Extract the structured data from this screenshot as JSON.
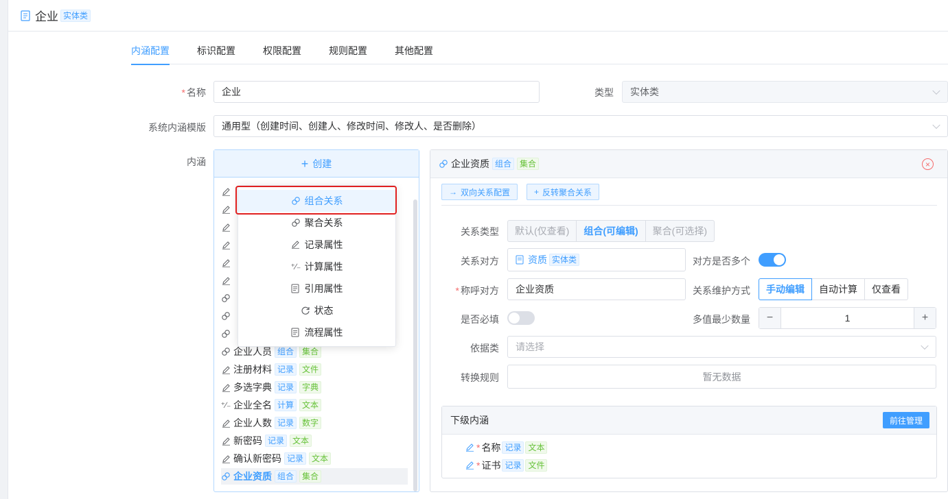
{
  "header": {
    "title": "企业",
    "tag": "实体类"
  },
  "tabs": [
    "内涵配置",
    "标识配置",
    "权限配置",
    "规则配置",
    "其他配置"
  ],
  "form": {
    "name_label": "名称",
    "name_value": "企业",
    "type_label": "类型",
    "type_value": "实体类",
    "template_label": "系统内涵模版",
    "template_value": "通用型（创建时间、创建人、修改时间、修改人、是否删除）",
    "connotation_label": "内涵"
  },
  "list_panel": {
    "create_label": "创建",
    "items": [
      {
        "icon": "pencil-icon",
        "label": "企业人员",
        "tags": [
          [
            "组合",
            "blue"
          ],
          [
            "集合",
            "green"
          ]
        ]
      },
      {
        "icon": "pencil-icon",
        "label": "注册材料",
        "tags": [
          [
            "记录",
            "blue"
          ],
          [
            "文件",
            "green"
          ]
        ]
      },
      {
        "icon": "pencil-icon",
        "label": "多选字典",
        "tags": [
          [
            "记录",
            "blue"
          ],
          [
            "字典",
            "green"
          ]
        ]
      },
      {
        "icon": "calc-icon",
        "label": "企业全名",
        "tags": [
          [
            "计算",
            "blue"
          ],
          [
            "文本",
            "green"
          ]
        ]
      },
      {
        "icon": "pencil-icon",
        "label": "企业人数",
        "tags": [
          [
            "记录",
            "blue"
          ],
          [
            "数字",
            "green"
          ]
        ]
      },
      {
        "icon": "pencil-icon",
        "label": "新密码",
        "tags": [
          [
            "记录",
            "blue"
          ],
          [
            "文本",
            "green"
          ]
        ]
      },
      {
        "icon": "pencil-icon",
        "label": "确认新密码",
        "tags": [
          [
            "记录",
            "blue"
          ],
          [
            "文本",
            "green"
          ]
        ]
      },
      {
        "icon": "link-icon",
        "label": "企业资质",
        "tags": [
          [
            "组合",
            "blue"
          ],
          [
            "集合",
            "green"
          ]
        ]
      }
    ]
  },
  "popup": {
    "items": [
      "组合关系",
      "聚合关系",
      "记录属性",
      "计算属性",
      "引用属性",
      "状态",
      "流程属性"
    ]
  },
  "detail": {
    "title": "企业资质",
    "tag1": "组合",
    "tag2": "集合",
    "btn_bidirectional": "双向关系配置",
    "btn_reverse": "反转聚合关系",
    "relation_type_label": "关系类型",
    "relation_type_options": [
      "默认(仅查看)",
      "组合(可编辑)",
      "聚合(可选择)"
    ],
    "counterpart_label": "关系对方",
    "counterpart_value": "资质",
    "counterpart_tag": "实体类",
    "multiple_label": "对方是否多个",
    "alias_label": "称呼对方",
    "alias_value": "企业资质",
    "maintain_label": "关系维护方式",
    "maintain_options": [
      "手动编辑",
      "自动计算",
      "仅查看"
    ],
    "required_label": "是否必填",
    "min_count_label": "多值最少数量",
    "min_count_value": "1",
    "basis_label": "依据类",
    "basis_placeholder": "请选择",
    "convert_label": "转换规则",
    "convert_empty": "暂无数据",
    "sub_title": "下级内涵",
    "sub_manage_btn": "前往管理",
    "sub_items": [
      {
        "label": "名称",
        "tags": [
          [
            "记录",
            "blue"
          ],
          [
            "文本",
            "green"
          ]
        ]
      },
      {
        "label": "证书",
        "tags": [
          [
            "记录",
            "blue"
          ],
          [
            "文件",
            "green"
          ]
        ]
      }
    ]
  },
  "colors": {
    "primary": "#409eff",
    "highlight_border": "#e02020",
    "success": "#67c23a",
    "danger": "#f56c6c"
  }
}
